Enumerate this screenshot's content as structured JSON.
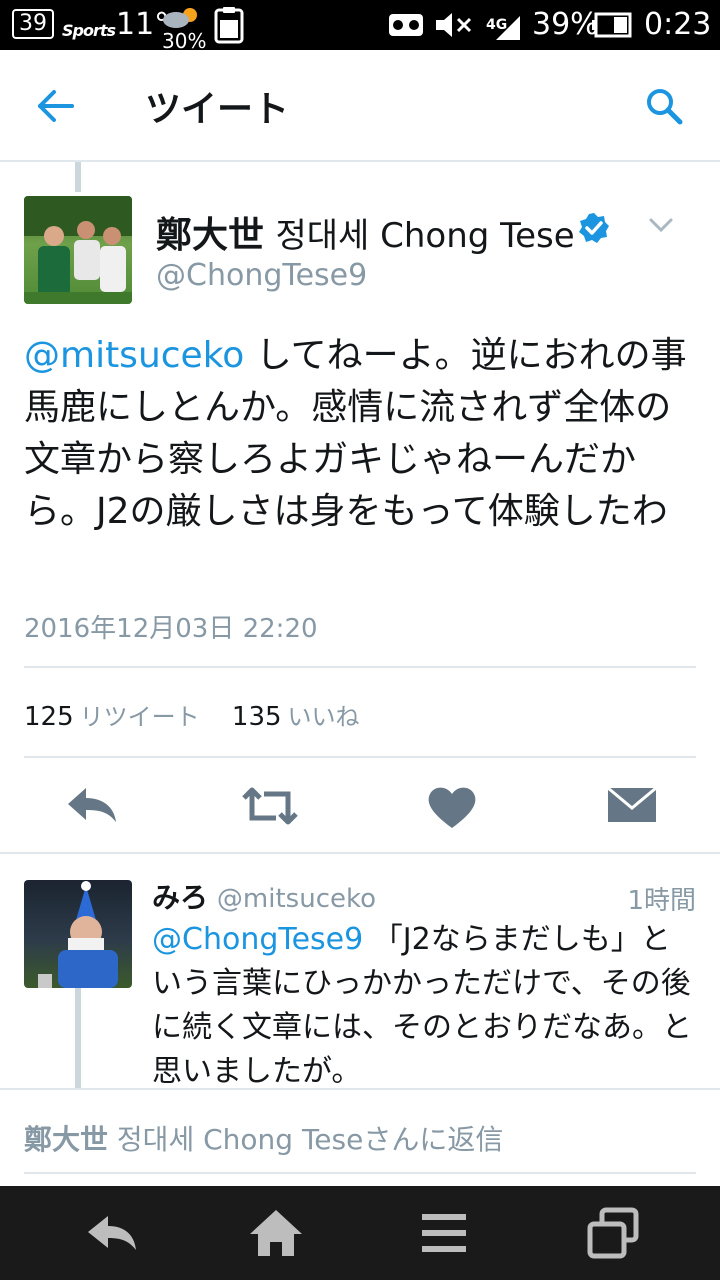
{
  "status_bar": {
    "notification_badge": "39",
    "sports_badge": "Sports",
    "temperature": "11°",
    "rain_chance": "30%",
    "network": "4G",
    "battery": "39%",
    "time": "0:23"
  },
  "header": {
    "title": "ツイート",
    "back_icon": "arrow-left-icon",
    "search_icon": "search-icon"
  },
  "tweet": {
    "display_name": "鄭大世",
    "display_name_rest": "정대세 Chong Tese",
    "handle": "@ChongTese9",
    "mention": "@mitsuceko",
    "text": "してねーよ。逆におれの事馬鹿にしとんか。感情に流されず全体の文章から察しろよガキじゃねーんだから。J2の厳しさは身をもって体験したわ",
    "timestamp": "2016年12月03日 22:20",
    "retweet_count": "125",
    "retweet_label": "リツイート",
    "like_count": "135",
    "like_label": "いいね"
  },
  "reply": {
    "display_name": "みろ",
    "handle": "@mitsuceko",
    "time": "1時間",
    "mention": "@ChongTese9",
    "text": "「J2ならまだしも」という言葉にひっかかっただけで、その後に続く文章には、そのとおりだなあ。と思いましたが。"
  },
  "compose": {
    "name": "鄭大世",
    "rest": "정대세 Chong Teseさんに返信"
  },
  "colors": {
    "accent": "#1b95e0",
    "muted": "#8899a6",
    "text": "#14171a"
  }
}
